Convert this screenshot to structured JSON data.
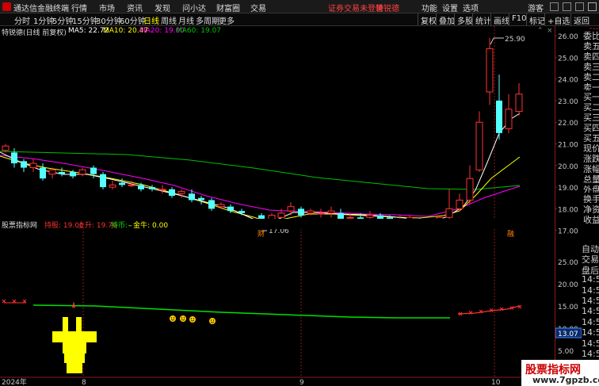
{
  "app": {
    "title": "通达信金融终端",
    "menus": [
      "行情",
      "市场",
      "资讯",
      "发现",
      "问小达",
      "财富圈",
      "交易"
    ],
    "warning": "证券交易未登录",
    "stock_name": "特锐德",
    "right_menus": [
      "功能",
      "设置",
      "选项",
      "游客"
    ]
  },
  "toolbar": {
    "periods": [
      "分时",
      "1分钟",
      "5分钟",
      "15分钟",
      "30分钟",
      "60分钟",
      "日线",
      "周线",
      "月线",
      "多周期",
      "更多"
    ],
    "active": "日线",
    "right": [
      "复权",
      "叠加",
      "多股",
      "统计",
      "画线",
      "F10",
      "标记",
      "+自选",
      "返回"
    ]
  },
  "main_info": {
    "name": "特锐德(日线 前复权)",
    "ma5": "MA5: 22.72",
    "ma10": "MA10: 20.47",
    "ma20": "MA20: 19.00",
    "ma60": "MA60: 19.07"
  },
  "indicator_info": {
    "name": "股票指标网",
    "a": "持股: 19.00",
    "b": "上升: 19.76",
    "c": "持币: -",
    "d": "- 金牛: 0.00"
  },
  "price_axis": [
    "26.00",
    "25.00",
    "24.00",
    "23.00",
    "22.00",
    "21.00",
    "20.00",
    "19.00",
    "18.00",
    "17.00"
  ],
  "ind_axis": [
    "25.00",
    "20.00",
    "15.00",
    "10.00",
    "5.00",
    "0.00"
  ],
  "ind_current": "13.07",
  "small_500": "500",
  "order_labels": [
    "委比",
    "卖五",
    "卖四",
    "卖三",
    "卖二",
    "卖一",
    "买一",
    "买二",
    "买三",
    "买四",
    "买五",
    "现价",
    "涨跌",
    "涨幅",
    "总量",
    "外盘",
    "换手",
    "净资",
    "收益"
  ],
  "right_lower": [
    "自动",
    "交易",
    "盘后",
    "14:50",
    "14:50",
    "14:50",
    "14:50",
    "14:50",
    "14:50",
    "14:50",
    "14:50",
    "14:50",
    "14:50"
  ],
  "annotations": {
    "high": "25.90",
    "low": "17.06",
    "cai": "财",
    "hong": "融"
  },
  "x_axis": [
    "2024年",
    "8",
    "9",
    "10"
  ],
  "watermark": {
    "line1": "股票指标网",
    "line2": "www.7gpzb.com"
  },
  "colors": {
    "up": "#ff3232",
    "down": "#54ffff",
    "ma5": "#ffffff",
    "ma10": "#ffff00",
    "ma20": "#ff00ff",
    "ma60": "#00c000",
    "signal_line": "#00e000"
  }
}
